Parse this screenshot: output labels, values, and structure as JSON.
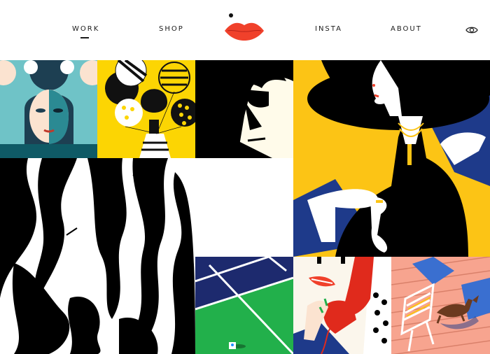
{
  "nav": {
    "items": [
      {
        "label": "WORK",
        "active": true
      },
      {
        "label": "SHOP"
      },
      {
        "label": "INSTA"
      },
      {
        "label": "ABOUT"
      }
    ],
    "logo_icon": "red-lips-logo-icon",
    "view_icon": "eye-icon"
  },
  "colors": {
    "accent_red": "#f0412b",
    "yellow": "#fcc415",
    "navy": "#1e3a8a",
    "black": "#000000",
    "cream": "#fffbea",
    "teal": "#6fc3c7",
    "green": "#22b04b",
    "pink": "#f7a48f"
  },
  "gallery": {
    "tiles": [
      {
        "name": "teal-faces-artwork"
      },
      {
        "name": "balloons-artwork"
      },
      {
        "name": "sunglasses-man-artwork"
      },
      {
        "name": "woman-black-hat-artwork"
      },
      {
        "name": "black-white-figures-artwork"
      },
      {
        "name": "blank-tile"
      },
      {
        "name": "tennis-court-artwork"
      },
      {
        "name": "red-phone-artwork"
      },
      {
        "name": "deck-dog-artwork"
      }
    ]
  }
}
